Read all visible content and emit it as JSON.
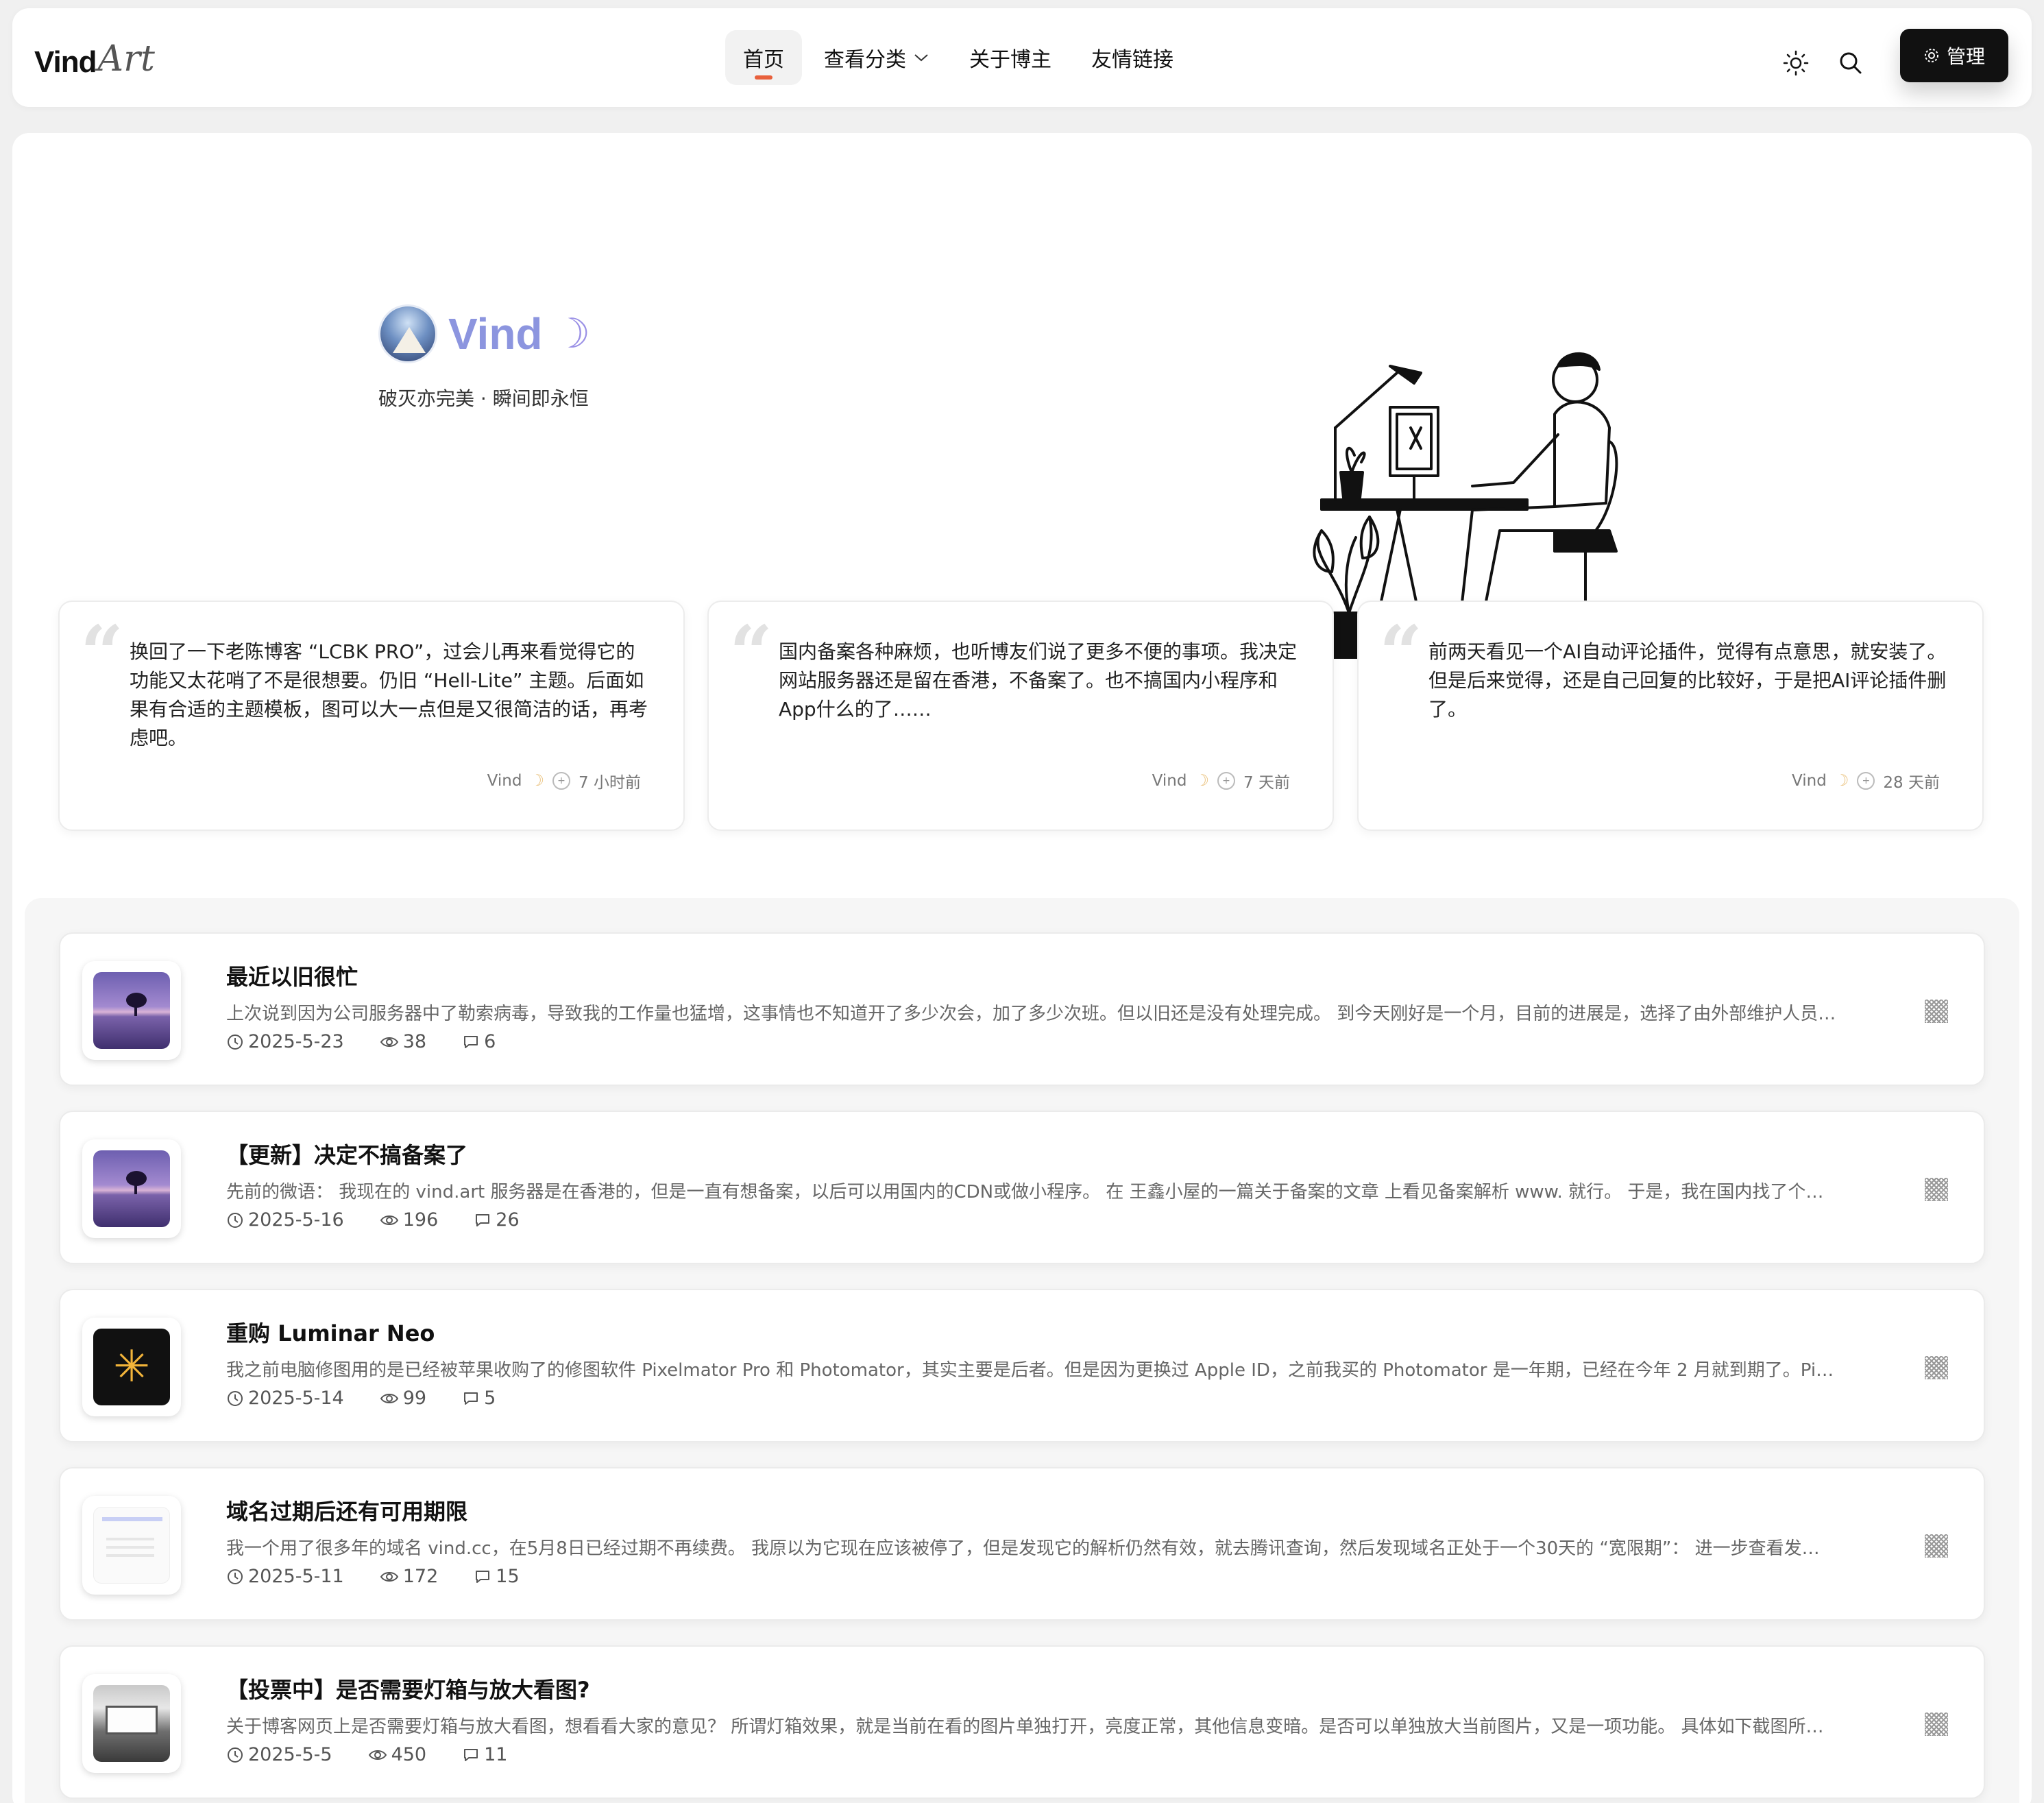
{
  "header": {
    "logo_main": "Vind",
    "logo_script": "Art",
    "nav": [
      {
        "label": "首页",
        "active": true
      },
      {
        "label": "查看分类",
        "has_dropdown": true
      },
      {
        "label": "关于博主"
      },
      {
        "label": "友情链接"
      }
    ],
    "theme_icon": "sun-icon",
    "search_icon": "search-icon",
    "admin_label": "管理",
    "admin_icon": "gear-icon"
  },
  "profile": {
    "name": "Vind",
    "moon": "☽",
    "motto": "破灭亦完美 · 瞬间即永恒"
  },
  "quotes": [
    {
      "text": "换回了一下老陈博客 “LCBK PRO”，过会儿再来看觉得它的功能又太花哨了不是很想要。仍旧 “Hell-Lite” 主题。后面如果有合适的主题模板，图可以大一点但是又很简洁的话，再考虑吧。",
      "author": "Vind",
      "time": "7 小时前"
    },
    {
      "text": "国内备案各种麻烦，也听博友们说了更多不便的事项。我决定网站服务器还是留在香港，不备案了。也不搞国内小程序和App什么的了……",
      "author": "Vind",
      "time": "7 天前"
    },
    {
      "text": "前两天看见一个AI自动评论插件，觉得有点意思，就安装了。 但是后来觉得，还是自己回复的比较好，于是把AI评论插件删了。",
      "author": "Vind",
      "time": "28 天前"
    }
  ],
  "posts": [
    {
      "title": "最近以旧很忙",
      "excerpt": "上次说到因为公司服务器中了勒索病毒，导致我的工作量也猛增，这事情也不知道开了多少次会，加了多少次班。但以旧还是没有处理完成。 到今天刚好是一个月，目前的进展是，选择了由外部维护人员去烟...",
      "date": "2025-5-23",
      "views": "38",
      "comments": "6",
      "thumb": "tree"
    },
    {
      "title": "【更新】决定不搞备案了",
      "excerpt": "先前的微语： 我现在的 vind.art 服务器是在香港的，但是一直有想备案，以后可以用国内的CDN或做小程序。 在 王鑫小屋的一篇关于备案的文章 上看见备案解析 www. 就行。 于是，我在国内找了个比较小...",
      "date": "2025-5-16",
      "views": "196",
      "comments": "26",
      "thumb": "tree"
    },
    {
      "title": "重购 Luminar Neo",
      "excerpt": "我之前电脑修图用的是已经被苹果收购了的修图软件 Pixelmator Pro 和 Photomator，其实主要是后者。但是因为更换过 Apple ID，之前我买的 Photomator 是一年期，已经在今年 2 月就到期了。Pixelmato...",
      "date": "2025-5-14",
      "views": "99",
      "comments": "5",
      "thumb": "neo"
    },
    {
      "title": "域名过期后还有可用期限",
      "excerpt": "我一个用了很多年的域名 vind.cc，在5月8日已经过期不再续费。 我原以为它现在应该被停了，但是发现它的解析仍然有效，就去腾讯查询，然后发现域名正处于一个30天的 “宽限期”： 进一步查看发现，它...",
      "date": "2025-5-11",
      "views": "172",
      "comments": "15",
      "thumb": "ui"
    },
    {
      "title": "【投票中】是否需要灯箱与放大看图?",
      "excerpt": "关于博客网页上是否需要灯箱与放大看图，想看看大家的意见？ 所谓灯箱效果，就是当前在看的图片单独打开，亮度正常，其他信息变暗。是否可以单独放大当前图片，又是一项功能。 具体如下截图所示： 有...",
      "date": "2025-5-5",
      "views": "450",
      "comments": "11",
      "thumb": "house"
    }
  ]
}
